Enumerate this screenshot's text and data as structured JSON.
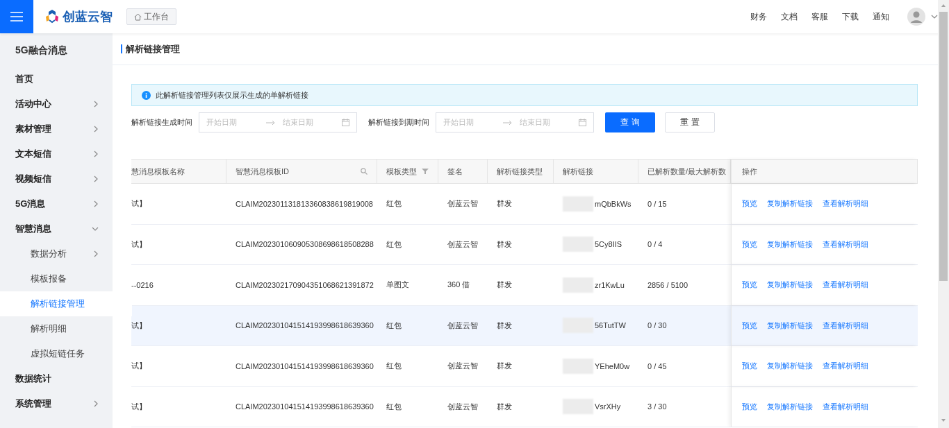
{
  "topbar": {
    "logo_text": "创蓝云智",
    "workbench_button": "工作台",
    "nav_links": [
      "财务",
      "文档",
      "客服",
      "下载",
      "通知"
    ]
  },
  "sidebar": {
    "title": "5G融合消息",
    "items": [
      {
        "label": "首页",
        "has_arrow": false
      },
      {
        "label": "活动中心",
        "has_arrow": true,
        "expanded": false
      },
      {
        "label": "素材管理",
        "has_arrow": true,
        "expanded": false
      },
      {
        "label": "文本短信",
        "has_arrow": true,
        "expanded": false
      },
      {
        "label": "视频短信",
        "has_arrow": true,
        "expanded": false
      },
      {
        "label": "5G消息",
        "has_arrow": true,
        "expanded": false
      },
      {
        "label": "智慧消息",
        "has_arrow": true,
        "expanded": true,
        "children": [
          {
            "label": "数据分析",
            "has_arrow": true,
            "selected": false
          },
          {
            "label": "模板报备",
            "has_arrow": false,
            "selected": false
          },
          {
            "label": "解析链接管理",
            "has_arrow": false,
            "selected": true
          },
          {
            "label": "解析明细",
            "has_arrow": false,
            "selected": false
          },
          {
            "label": "虚拟短链任务",
            "has_arrow": false,
            "selected": false
          }
        ]
      },
      {
        "label": "数据统计",
        "has_arrow": false
      },
      {
        "label": "系统管理",
        "has_arrow": true,
        "expanded": false
      }
    ]
  },
  "page_title": "解析链接管理",
  "alert": "此解析链接管理列表仅展示生成的单解析链接",
  "filters": [
    {
      "label": "解析链接生成时间",
      "start_placeholder": "开始日期",
      "end_placeholder": "结束日期"
    },
    {
      "label": "解析链接到期时间",
      "start_placeholder": "开始日期",
      "end_placeholder": "结束日期"
    }
  ],
  "buttons": {
    "query": "查 询",
    "reset": "重 置"
  },
  "table": {
    "columns": [
      "慧消息模板名称",
      "智慧消息模板ID",
      "模板类型",
      "签名",
      "解析链接类型",
      "解析链接",
      "已解析数量/最大解析数",
      "操作"
    ],
    "rows": [
      {
        "highlighted": false,
        "cells": [
          "试】",
          "CLAIM202301131813360838619819008",
          "红包",
          "创蓝云智",
          "群发",
          "mQbBkWs",
          "0 / 15"
        ],
        "actions": [
          "预览",
          "复制解析链接",
          "查看解析明细"
        ]
      },
      {
        "highlighted": false,
        "cells": [
          "试】",
          "CLAIM202301060905308698618508288",
          "红包",
          "创蓝云智",
          "群发",
          "5Cy8IIS",
          "0 / 4"
        ],
        "actions": [
          "预览",
          "复制解析链接",
          "查看解析明细"
        ]
      },
      {
        "highlighted": false,
        "cells": [
          "--0216",
          "CLAIM202302170904351068621391872",
          "单图文",
          "360 借",
          "群发",
          "zr1KwLu",
          "2856 / 5100"
        ],
        "actions": [
          "预览",
          "复制解析链接",
          "查看解析明细"
        ]
      },
      {
        "highlighted": true,
        "cells": [
          "试】",
          "CLAIM202301041514193998618639360",
          "红包",
          "创蓝云智",
          "群发",
          "56TutTW",
          "0 / 30"
        ],
        "actions": [
          "预览",
          "复制解析链接",
          "查看解析明细"
        ]
      },
      {
        "highlighted": false,
        "cells": [
          "试】",
          "CLAIM202301041514193998618639360",
          "红包",
          "创蓝云智",
          "群发",
          "YEheM0w",
          "0 / 45"
        ],
        "actions": [
          "预览",
          "复制解析链接",
          "查看解析明细"
        ]
      },
      {
        "highlighted": false,
        "cells": [
          "试】",
          "CLAIM202301041514193998618639360",
          "红包",
          "创蓝云智",
          "群发",
          "VsrXHy",
          "3 / 30"
        ],
        "actions": [
          "预览",
          "复制解析链接",
          "查看解析明细"
        ]
      }
    ]
  }
}
